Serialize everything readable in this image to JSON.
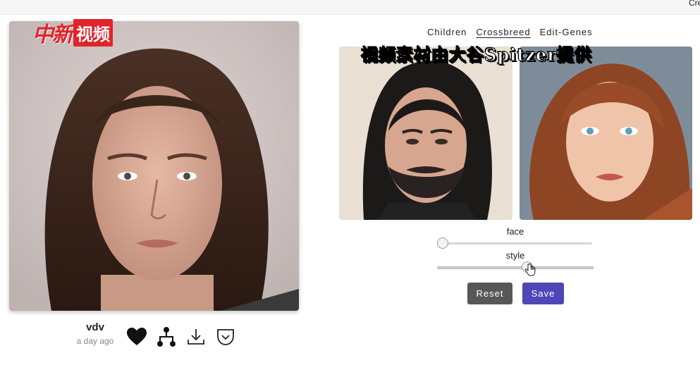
{
  "top_corner_text": "Crea",
  "watermark": {
    "brand_red": "中新",
    "brand_box": "视频"
  },
  "profile": {
    "username": "vdv",
    "timestamp": "a day ago"
  },
  "actions": {
    "like_icon": "heart-icon",
    "lineage_icon": "tree-icon",
    "download_icon": "download-icon",
    "share_icon": "pocket-icon"
  },
  "tabs": [
    {
      "label": "Children",
      "active": false
    },
    {
      "label": "Crossbreed",
      "active": true
    },
    {
      "label": "Edit-Genes",
      "active": false
    }
  ],
  "caption": "视频素材由大谷Spitzer提供",
  "sliders": [
    {
      "label": "face",
      "value": 0.0
    },
    {
      "label": "style",
      "value": 0.58
    }
  ],
  "buttons": {
    "reset": "Reset",
    "save": "Save"
  },
  "colors": {
    "save_bg": "#4f46b8",
    "reset_bg": "#575757",
    "brand_red": "#e0242b"
  }
}
